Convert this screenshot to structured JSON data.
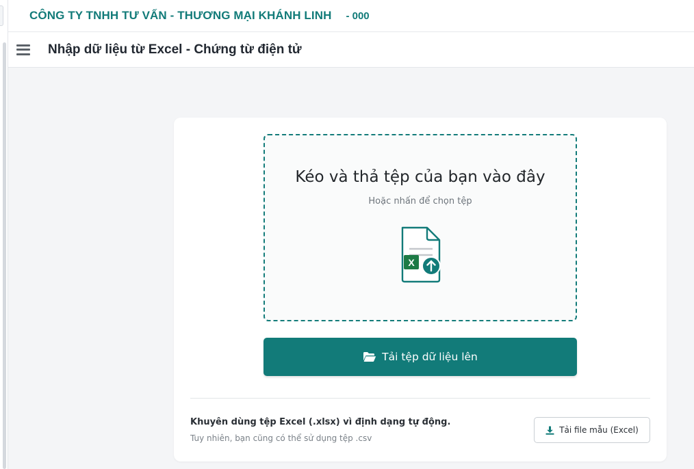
{
  "header": {
    "company_name": "CÔNG TY TNHH TƯ VẤN - THƯƠNG MẠI KHÁNH LINH",
    "company_code": "- 000"
  },
  "page": {
    "title": "Nhập dữ liệu từ Excel - Chứng từ điện tử",
    "menu_icon": "hamburger-icon"
  },
  "dropzone": {
    "title": "Kéo và thả tệp của bạn vào đây",
    "subtitle": "Hoặc nhấn để chọn tệp",
    "icon": "excel-file-upload-icon"
  },
  "upload_button": {
    "label": "Tải tệp dữ liệu lên",
    "icon": "folder-open-icon"
  },
  "hint": {
    "main": "Khuyên dùng tệp Excel (.xlsx) vì định dạng tự động.",
    "sub": "Tuy nhiên, bạn cũng có thể sử dụng tệp .csv"
  },
  "template_button": {
    "label": "Tải file mẫu (Excel)",
    "icon": "download-icon"
  },
  "colors": {
    "primary": "#127b79",
    "excel_green": "#1d7a45",
    "background": "#f4f5f7"
  }
}
